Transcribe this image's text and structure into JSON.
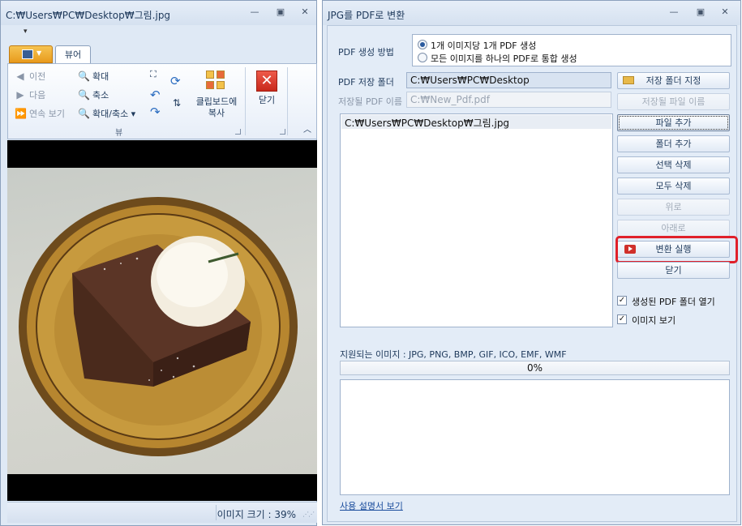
{
  "viewer": {
    "title": "C:₩Users₩PC₩Desktop₩그림.jpg",
    "tab_label": "뷰어",
    "prev_label": "이전",
    "next_label": "다음",
    "slideshow_label": "연속 보기",
    "zoom_in_label": "확대",
    "zoom_out_label": "축소",
    "zoom_label": "확대/축소",
    "group_label": "뷰",
    "clipboard_label": "클립보드에\n복사",
    "close_label": "닫기",
    "status_label": "이미지 크기 : 39%"
  },
  "converter": {
    "title": "JPG를 PDF로 변환",
    "method_label": "PDF 생성 방법",
    "option1": "1개 이미지당 1개 PDF 생성",
    "option2": "모든 이미지를 하나의 PDF로 통합 생성",
    "folder_label": "PDF 저장 폴더",
    "folder_value": "C:₩Users₩PC₩Desktop",
    "filename_label": "저장될 PDF 이름",
    "filename_value": "C:₩New_Pdf.pdf",
    "files": [
      "C:₩Users₩PC₩Desktop₩그림.jpg"
    ],
    "buttons": {
      "set_folder": "저장 폴더 지정",
      "set_filename": "저장될 파일 이름",
      "add_file": "파일 추가",
      "add_folder": "폴더 추가",
      "delete_selected": "선택 삭제",
      "delete_all": "모두 삭제",
      "move_up": "위로",
      "move_down": "아래로",
      "convert": "변환 실행",
      "close": "닫기"
    },
    "open_folder_label": "생성된 PDF 폴더 열기",
    "view_image_label": "이미지 보기",
    "supported_label": "지원되는 이미지 : JPG, PNG, BMP, GIF, ICO, EMF, WMF",
    "progress_text": "0%",
    "progress_value": 0,
    "help_link": "사용 설명서 보기"
  }
}
